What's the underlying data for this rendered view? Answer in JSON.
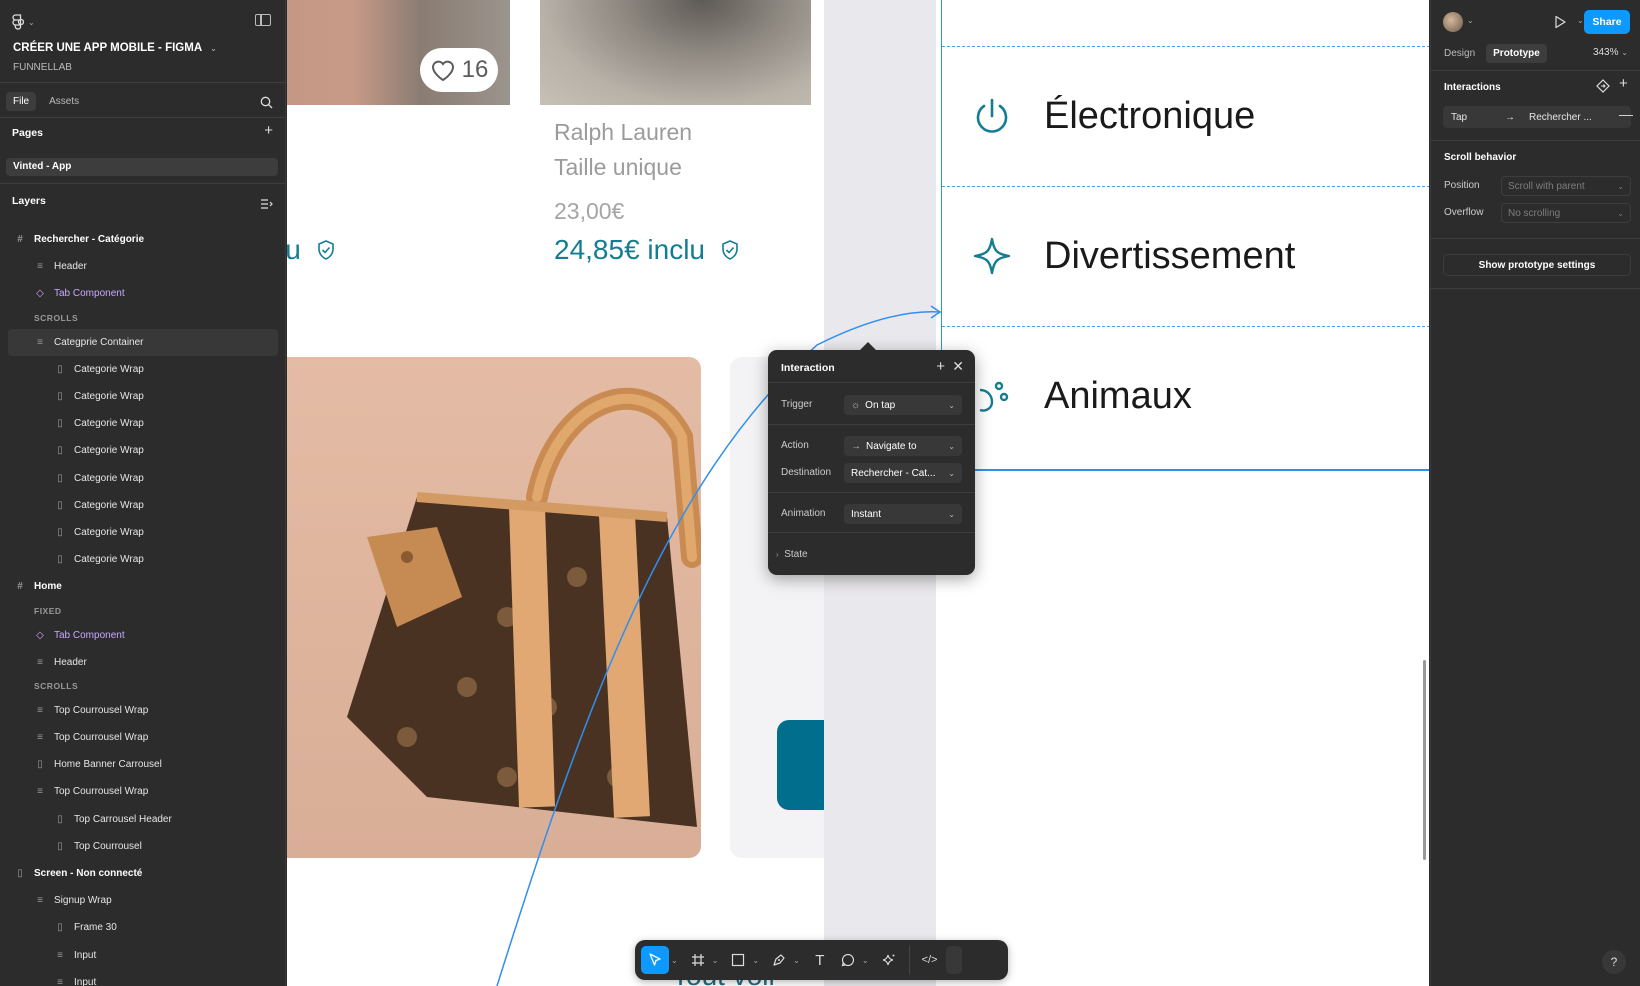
{
  "file": {
    "title": "CRÉER UNE APP MOBILE - FIGMA",
    "team": "FUNNELLAB"
  },
  "left_tabs": {
    "file": "File",
    "assets": "Assets"
  },
  "pages": {
    "heading": "Pages",
    "current": "Vinted - App"
  },
  "layers": {
    "heading": "Layers",
    "items": [
      {
        "label": "Rechercher - Catégorie",
        "type": "frame",
        "level": 0
      },
      {
        "label": "Header",
        "type": "stack",
        "level": 1
      },
      {
        "label": "Tab Component",
        "type": "component",
        "level": 1
      },
      {
        "label": "SCROLLS",
        "type": "section",
        "level": 1
      },
      {
        "label": "Categprie Container",
        "type": "stack",
        "level": 1,
        "selected": true
      },
      {
        "label": "Categorie Wrap",
        "type": "hstack",
        "level": 2
      },
      {
        "label": "Categorie Wrap",
        "type": "hstack",
        "level": 2
      },
      {
        "label": "Categorie Wrap",
        "type": "hstack",
        "level": 2
      },
      {
        "label": "Categorie Wrap",
        "type": "hstack",
        "level": 2
      },
      {
        "label": "Categorie Wrap",
        "type": "hstack",
        "level": 2
      },
      {
        "label": "Categorie Wrap",
        "type": "hstack",
        "level": 2
      },
      {
        "label": "Categorie Wrap",
        "type": "hstack",
        "level": 2
      },
      {
        "label": "Categorie Wrap",
        "type": "hstack",
        "level": 2
      },
      {
        "label": "Home",
        "type": "frame",
        "level": 0
      },
      {
        "label": "FIXED",
        "type": "section",
        "level": 1
      },
      {
        "label": "Tab Component",
        "type": "component",
        "level": 1
      },
      {
        "label": "Header",
        "type": "stack",
        "level": 1
      },
      {
        "label": "SCROLLS",
        "type": "section",
        "level": 1
      },
      {
        "label": "Top Courrousel Wrap",
        "type": "stack",
        "level": 1
      },
      {
        "label": "Top Courrousel Wrap",
        "type": "stack",
        "level": 1
      },
      {
        "label": "Home Banner Carrousel",
        "type": "hstack",
        "level": 1
      },
      {
        "label": "Top Courrousel Wrap",
        "type": "stack",
        "level": 1
      },
      {
        "label": "Top Carrousel Header",
        "type": "hstack",
        "level": 2
      },
      {
        "label": "Top Courrousel",
        "type": "hstack",
        "level": 2
      },
      {
        "label": "Screen - Non connecté",
        "type": "hframe",
        "level": 0
      },
      {
        "label": "Signup Wrap",
        "type": "stack",
        "level": 1
      },
      {
        "label": "Frame 30",
        "type": "hstack",
        "level": 2
      },
      {
        "label": "Input",
        "type": "stack",
        "level": 2
      },
      {
        "label": "Input",
        "type": "stack",
        "level": 2
      }
    ]
  },
  "canvas": {
    "likes": "16",
    "product": {
      "brand": "Ralph Lauren",
      "size": "Taille unique",
      "price": "23,00€",
      "price_incl": "24,85€ inclu"
    },
    "left_price_partial": "lu",
    "categories": [
      {
        "label": "Électronique",
        "icon": "power-icon"
      },
      {
        "label": "Divertissement",
        "icon": "sparkle-icon"
      },
      {
        "label": "Animaux",
        "icon": "paw-icon"
      }
    ],
    "bottom_partial_text": "Tout voir"
  },
  "interaction_popup": {
    "title": "Interaction",
    "trigger_label": "Trigger",
    "trigger_value": "On tap",
    "action_label": "Action",
    "action_value": "Navigate to",
    "destination_label": "Destination",
    "destination_value": "Rechercher - Cat...",
    "animation_label": "Animation",
    "animation_value": "Instant",
    "state_label": "State"
  },
  "right_panel": {
    "share": "Share",
    "tab_design": "Design",
    "tab_prototype": "Prototype",
    "zoom": "343%",
    "interactions_heading": "Interactions",
    "interaction_trigger": "Tap",
    "interaction_destination": "Rechercher ...",
    "scroll_heading": "Scroll behavior",
    "position_label": "Position",
    "position_value": "Scroll with parent",
    "overflow_label": "Overflow",
    "overflow_value": "No scrolling",
    "proto_settings": "Show prototype settings",
    "help": "?"
  },
  "colors": {
    "accent": "#0d99ff",
    "brand_teal": "#157d92",
    "selection_blue": "#2f8ff0",
    "component_purple": "#c9a7ff"
  }
}
